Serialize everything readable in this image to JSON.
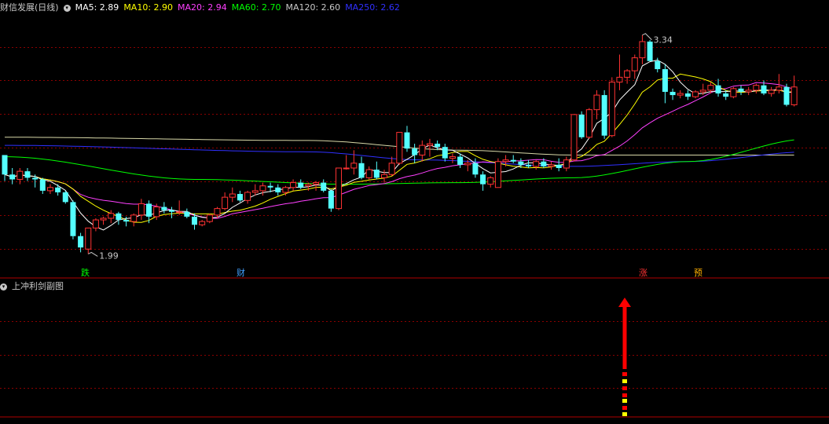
{
  "header": {
    "title": "财信发展(日线)",
    "ma_items": [
      {
        "label": "MA5: 2.89",
        "color": "#ffffff"
      },
      {
        "label": "MA10: 2.90",
        "color": "#ffff00"
      },
      {
        "label": "MA20: 2.94",
        "color": "#ff40ff"
      },
      {
        "label": "MA60: 2.70",
        "color": "#00ff00"
      },
      {
        "label": "MA120: 2.60",
        "color": "#c8c8c8"
      },
      {
        "label": "MA250: 2.62",
        "color": "#3030ff"
      }
    ]
  },
  "signals": {
    "die": "跌",
    "cai": "财",
    "zhang": "涨",
    "yu": "预"
  },
  "annotations": {
    "high": "3.34",
    "low": "1.99"
  },
  "sub_panel": {
    "title": "上冲利剑副图",
    "bottom_text": "..."
  },
  "colors": {
    "up": "#ff3232",
    "down": "#54ffff",
    "grid": "#8b0000",
    "ma5": "#ffffff",
    "ma10": "#ffff00",
    "ma20": "#ff40ff",
    "ma60": "#00ff00",
    "ma120": "#d8d8a8",
    "ma250": "#3030ff",
    "arrow": "#ff0000",
    "dash_yellow": "#ffff00"
  },
  "chart_data": {
    "type": "candlestick",
    "ohlc": [
      [
        2.6,
        2.6,
        2.44,
        2.48
      ],
      [
        2.48,
        2.52,
        2.42,
        2.45
      ],
      [
        2.45,
        2.52,
        2.42,
        2.5
      ],
      [
        2.5,
        2.52,
        2.44,
        2.46
      ],
      [
        2.46,
        2.48,
        2.4,
        2.45
      ],
      [
        2.45,
        2.46,
        2.36,
        2.38
      ],
      [
        2.38,
        2.42,
        2.36,
        2.4
      ],
      [
        2.4,
        2.42,
        2.35,
        2.37
      ],
      [
        2.37,
        2.38,
        2.3,
        2.31
      ],
      [
        2.31,
        2.32,
        2.08,
        2.1
      ],
      [
        2.1,
        2.12,
        2.0,
        2.03
      ],
      [
        2.02,
        2.15,
        1.99,
        2.15
      ],
      [
        2.15,
        2.21,
        2.13,
        2.2
      ],
      [
        2.2,
        2.22,
        2.17,
        2.21
      ],
      [
        2.21,
        2.26,
        2.18,
        2.24
      ],
      [
        2.24,
        2.25,
        2.17,
        2.2
      ],
      [
        2.2,
        2.22,
        2.16,
        2.19
      ],
      [
        2.19,
        2.24,
        2.16,
        2.23
      ],
      [
        2.23,
        2.33,
        2.2,
        2.3
      ],
      [
        2.3,
        2.32,
        2.18,
        2.22
      ],
      [
        2.22,
        2.3,
        2.2,
        2.28
      ],
      [
        2.28,
        2.31,
        2.24,
        2.26
      ],
      [
        2.26,
        2.28,
        2.21,
        2.25
      ],
      [
        2.25,
        2.32,
        2.23,
        2.25
      ],
      [
        2.25,
        2.27,
        2.21,
        2.22
      ],
      [
        2.22,
        2.24,
        2.14,
        2.17
      ],
      [
        2.17,
        2.2,
        2.16,
        2.19
      ],
      [
        2.19,
        2.24,
        2.18,
        2.23
      ],
      [
        2.23,
        2.28,
        2.21,
        2.27
      ],
      [
        2.27,
        2.37,
        2.26,
        2.34
      ],
      [
        2.34,
        2.4,
        2.31,
        2.36
      ],
      [
        2.36,
        2.38,
        2.31,
        2.32
      ],
      [
        2.32,
        2.38,
        2.3,
        2.37
      ],
      [
        2.37,
        2.42,
        2.35,
        2.38
      ],
      [
        2.38,
        2.43,
        2.35,
        2.41
      ],
      [
        2.41,
        2.43,
        2.37,
        2.4
      ],
      [
        2.4,
        2.42,
        2.35,
        2.37
      ],
      [
        2.37,
        2.41,
        2.35,
        2.4
      ],
      [
        2.4,
        2.45,
        2.38,
        2.43
      ],
      [
        2.43,
        2.45,
        2.39,
        2.4
      ],
      [
        2.41,
        2.43,
        2.38,
        2.42
      ],
      [
        2.42,
        2.44,
        2.38,
        2.43
      ],
      [
        2.43,
        2.45,
        2.37,
        2.38
      ],
      [
        2.38,
        2.39,
        2.25,
        2.27
      ],
      [
        2.27,
        2.52,
        2.26,
        2.52
      ],
      [
        2.52,
        2.6,
        2.51,
        2.52
      ],
      [
        2.52,
        2.63,
        2.48,
        2.55
      ],
      [
        2.55,
        2.59,
        2.45,
        2.46
      ],
      [
        2.46,
        2.53,
        2.45,
        2.51
      ],
      [
        2.51,
        2.56,
        2.45,
        2.46
      ],
      [
        2.46,
        2.51,
        2.43,
        2.48
      ],
      [
        2.48,
        2.59,
        2.47,
        2.55
      ],
      [
        2.55,
        2.74,
        2.54,
        2.74
      ],
      [
        2.74,
        2.78,
        2.62,
        2.64
      ],
      [
        2.64,
        2.67,
        2.55,
        2.6
      ],
      [
        2.6,
        2.69,
        2.56,
        2.66
      ],
      [
        2.66,
        2.7,
        2.59,
        2.67
      ],
      [
        2.67,
        2.69,
        2.63,
        2.65
      ],
      [
        2.65,
        2.67,
        2.56,
        2.58
      ],
      [
        2.58,
        2.61,
        2.55,
        2.59
      ],
      [
        2.59,
        2.61,
        2.52,
        2.54
      ],
      [
        2.54,
        2.57,
        2.5,
        2.55
      ],
      [
        2.55,
        2.58,
        2.46,
        2.48
      ],
      [
        2.48,
        2.5,
        2.38,
        2.42
      ],
      [
        2.42,
        2.47,
        2.4,
        2.46
      ],
      [
        2.4,
        2.58,
        2.4,
        2.56
      ],
      [
        2.56,
        2.6,
        2.53,
        2.57
      ],
      [
        2.57,
        2.6,
        2.55,
        2.56
      ],
      [
        2.56,
        2.58,
        2.52,
        2.54
      ],
      [
        2.54,
        2.57,
        2.52,
        2.53
      ],
      [
        2.53,
        2.57,
        2.51,
        2.56
      ],
      [
        2.56,
        2.58,
        2.52,
        2.53
      ],
      [
        2.53,
        2.56,
        2.51,
        2.54
      ],
      [
        2.54,
        2.58,
        2.5,
        2.52
      ],
      [
        2.52,
        2.59,
        2.5,
        2.57
      ],
      [
        2.57,
        2.85,
        2.56,
        2.85
      ],
      [
        2.85,
        2.87,
        2.7,
        2.71
      ],
      [
        2.71,
        2.89,
        2.7,
        2.88
      ],
      [
        2.88,
        3.0,
        2.82,
        2.97
      ],
      [
        2.97,
        3.0,
        2.7,
        2.72
      ],
      [
        2.72,
        3.08,
        2.71,
        3.05
      ],
      [
        3.05,
        3.22,
        3.0,
        3.08
      ],
      [
        3.08,
        3.13,
        3.04,
        3.12
      ],
      [
        3.12,
        3.22,
        3.07,
        3.2
      ],
      [
        3.2,
        3.34,
        3.16,
        3.3
      ],
      [
        3.3,
        3.31,
        3.18,
        3.18
      ],
      [
        3.18,
        3.2,
        3.11,
        3.13
      ],
      [
        3.13,
        3.16,
        2.92,
        2.99
      ],
      [
        2.99,
        3.01,
        2.94,
        2.97
      ],
      [
        2.97,
        3.0,
        2.95,
        2.98
      ],
      [
        2.98,
        3.0,
        2.94,
        2.96
      ],
      [
        2.96,
        3.0,
        2.95,
        2.99
      ],
      [
        2.99,
        3.04,
        2.97,
        3.0
      ],
      [
        3.0,
        3.05,
        2.98,
        3.03
      ],
      [
        3.03,
        3.07,
        2.96,
        2.98
      ],
      [
        2.98,
        3.0,
        2.94,
        2.96
      ],
      [
        2.96,
        3.02,
        2.95,
        3.01
      ],
      [
        3.01,
        3.03,
        2.97,
        2.99
      ],
      [
        2.99,
        3.02,
        2.97,
        3.0
      ],
      [
        3.0,
        3.04,
        2.98,
        3.03
      ],
      [
        3.03,
        3.06,
        2.97,
        2.98
      ],
      [
        2.98,
        3.02,
        2.96,
        3.0
      ],
      [
        3.0,
        3.1,
        2.98,
        3.02
      ],
      [
        3.02,
        3.04,
        2.9,
        2.91
      ],
      [
        2.91,
        3.09,
        2.9,
        3.02
      ]
    ],
    "ma_levels": {
      "MA5": 2.89,
      "MA10": 2.9,
      "MA20": 2.94,
      "MA60": 2.7,
      "MA120": 2.6,
      "MA250": 2.62
    },
    "ma120_line": [
      [
        0,
        2.71
      ],
      [
        40,
        2.69
      ],
      [
        60,
        2.63
      ],
      [
        75,
        2.6
      ],
      [
        90,
        2.6
      ],
      [
        106,
        2.6
      ]
    ],
    "ma250_line": [
      [
        0,
        2.66
      ],
      [
        40,
        2.62
      ],
      [
        55,
        2.57
      ],
      [
        75,
        2.53
      ],
      [
        90,
        2.56
      ],
      [
        106,
        2.62
      ]
    ],
    "ma60_line": [
      [
        0,
        2.59
      ],
      [
        25,
        2.45
      ],
      [
        45,
        2.42
      ],
      [
        60,
        2.43
      ],
      [
        75,
        2.46
      ],
      [
        90,
        2.56
      ],
      [
        106,
        2.7
      ]
    ],
    "price_range": [
      1.9,
      3.45
    ]
  }
}
